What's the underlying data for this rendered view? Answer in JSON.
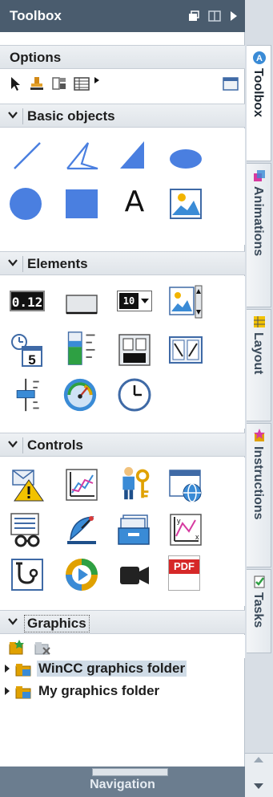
{
  "titlebar": {
    "title": "Toolbox"
  },
  "options": {
    "label": "Options"
  },
  "sections": {
    "basic_objects": "Basic objects",
    "elements": "Elements",
    "controls": "Controls",
    "graphics": "Graphics"
  },
  "basic_objects_icons": [
    "line-icon",
    "polyline-icon",
    "polygon-icon",
    "ellipse-icon",
    "circle-icon",
    "rectangle-icon",
    "text-field-icon",
    "graphic-view-icon"
  ],
  "text_field_glyph": "A",
  "elements_icons": [
    "io-field-icon",
    "button-icon",
    "symbolic-io-field-icon",
    "graphic-io-field-icon",
    "datetime-field-icon",
    "bar-icon",
    "switch-icon",
    "symbol-library-icon",
    "slider-icon",
    "gauge-icon",
    "clock-icon"
  ],
  "io_field_text": "0.12",
  "io_symbolic_text": "10",
  "datetime_text": "5",
  "controls_icons": [
    "alarm-view-icon",
    "trend-view-icon",
    "user-view-icon",
    "html-browser-icon",
    "recipe-view-icon",
    "sm-query-icon",
    "media-player-icon",
    "f-x-trend-view-icon",
    "system-diagnostics-icon",
    "media-play-icon",
    "camera-control-icon",
    "pdf-view-icon"
  ],
  "pdf_text": "PDF",
  "graphics_tree": [
    {
      "label": "WinCC graphics folder",
      "selected": true
    },
    {
      "label": "My graphics folder",
      "selected": false
    }
  ],
  "bottom": {
    "navigation": "Navigation"
  },
  "tabs": [
    {
      "label": "Toolbox",
      "active": true
    },
    {
      "label": "Animations",
      "active": false
    },
    {
      "label": "Layout",
      "active": false
    },
    {
      "label": "Instructions",
      "active": false
    },
    {
      "label": "Tasks",
      "active": false
    }
  ],
  "colors": {
    "title_bg": "#4a5c6e",
    "accent_blue": "#4a7fe0",
    "selection": "#cfdbe6"
  }
}
